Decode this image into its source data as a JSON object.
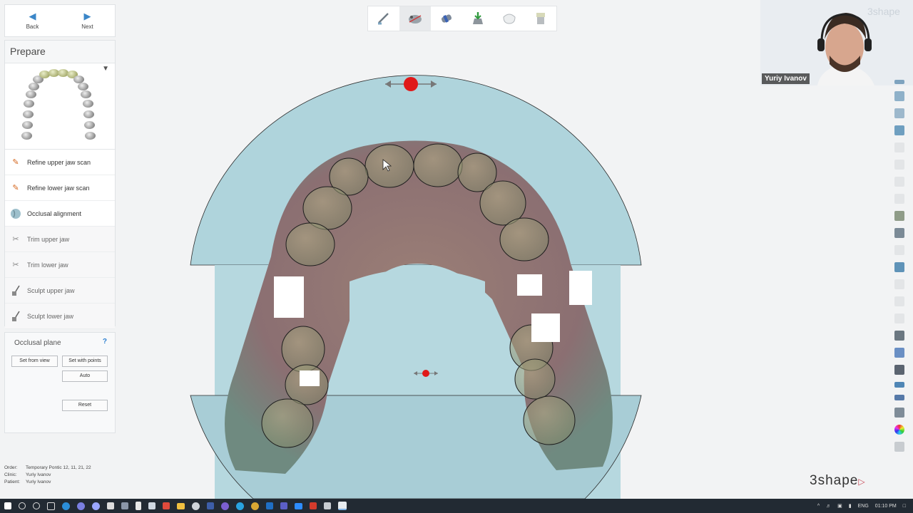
{
  "nav": {
    "back_label": "Back",
    "next_label": "Next"
  },
  "prepare": {
    "title": "Prepare",
    "steps": [
      {
        "label": "Refine upper jaw scan",
        "icon": "refine-scan-icon"
      },
      {
        "label": "Refine lower jaw scan",
        "icon": "refine-scan-icon"
      },
      {
        "label": "Occlusal alignment",
        "icon": "occlusal-alignment-icon"
      },
      {
        "label": "Trim upper jaw",
        "icon": "trim-jaw-icon"
      },
      {
        "label": "Trim lower jaw",
        "icon": "trim-jaw-icon"
      },
      {
        "label": "Sculpt upper jaw",
        "icon": "sculpt-jaw-icon"
      },
      {
        "label": "Sculpt lower jaw",
        "icon": "sculpt-jaw-icon"
      }
    ]
  },
  "occlusal_plane": {
    "title": "Occlusal plane",
    "help": "?",
    "set_from_view": "Set from view",
    "set_with_points": "Set with points",
    "auto": "Auto",
    "reset": "Reset"
  },
  "order_info": {
    "order_label": "Order:",
    "order_value": "Temporary Pontic 12, 11, 21, 22",
    "clinic_label": "Clinic:",
    "clinic_value": "Yuriy Ivanov",
    "patient_label": "Patient:",
    "patient_value": "Yuriy Ivanov"
  },
  "toolbar": {
    "icons": [
      "scalpel-icon",
      "jaw-scan-icon",
      "margin-tool-icon",
      "insertion-direction-icon",
      "tooth-icon",
      "die-icon"
    ]
  },
  "video": {
    "name": "Yuriy Ivanov",
    "watermark": "3shape"
  },
  "logo": {
    "text": "3shape"
  },
  "taskbar": {
    "lang": "ENG",
    "time": "01:10 PM"
  },
  "colors": {
    "accent": "#3b86c8",
    "handle": "#e01919",
    "scan_disc": "#afd4dc",
    "logo_mark": "#c94a57"
  }
}
